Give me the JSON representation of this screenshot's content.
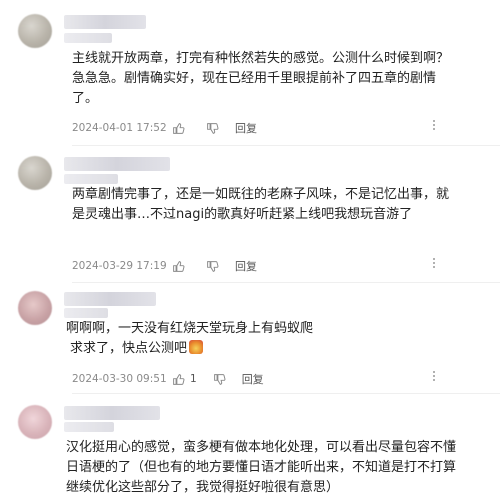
{
  "comments": [
    {
      "text": "主线就开放两章，打完有种怅然若失的感觉。公测什么时候到啊？急急急。剧情确实好，现在已经用千里眼提前补了四五章的剧情了。",
      "time": "2024-04-01 17:52",
      "likes": "",
      "reply_label": "回复"
    },
    {
      "text": "两章剧情完事了，还是一如既往的老麻子风味，不是记忆出事，就是灵魂出事…不过nagi的歌真好听赶紧上线吧我想玩音游了",
      "time": "2024-03-29 17:19",
      "likes": "",
      "reply_label": "回复"
    },
    {
      "text": "啊啊啊，一天没有红烧天堂玩身上有蚂蚁爬 求求了，快点公测吧",
      "text_line1": "啊啊啊，一天没有红烧天堂玩身上有蚂蚁爬",
      "text_line2": "求求了，快点公测吧",
      "time": "2024-03-30 09:51",
      "likes": "1",
      "reply_label": "回复"
    },
    {
      "text": "汉化挺用心的感觉，蛮多梗有做本地化处理，可以看出尽量包容不懂日语梗的了（但也有的地方要懂日语才能听出来，不知道是打不打算继续优化这些部分了，我觉得挺好啦很有意思）",
      "time": "",
      "likes": "",
      "reply_label": ""
    }
  ]
}
